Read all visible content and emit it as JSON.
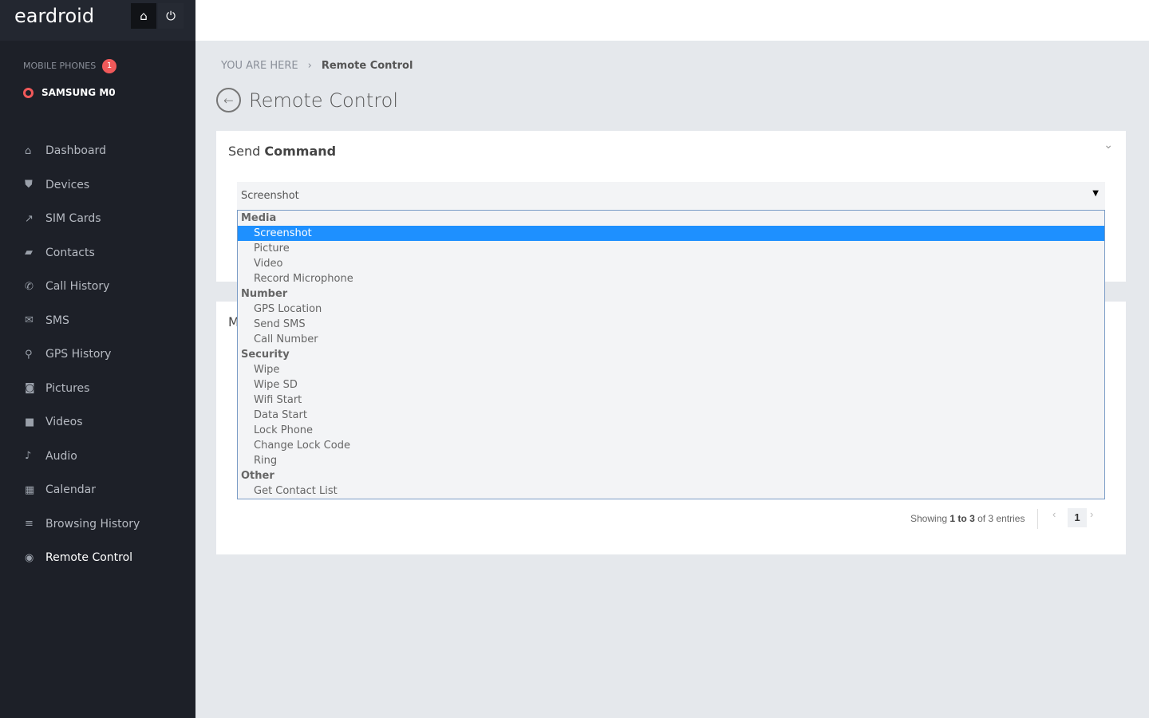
{
  "brand": {
    "logo": "eardroid",
    "home_icon": "home-icon",
    "power_icon": "power-icon"
  },
  "sidebar": {
    "section_label": "MOBILE PHONES",
    "badge": "1",
    "phone": "SAMSUNG M0",
    "items": [
      {
        "label": "Dashboard",
        "icon": "⌂"
      },
      {
        "label": "Devices",
        "icon": "⛊"
      },
      {
        "label": "SIM Cards",
        "icon": "↗"
      },
      {
        "label": "Contacts",
        "icon": "▰"
      },
      {
        "label": "Call History",
        "icon": "✆"
      },
      {
        "label": "SMS",
        "icon": "✉"
      },
      {
        "label": "GPS History",
        "icon": "⚲"
      },
      {
        "label": "Pictures",
        "icon": "◙"
      },
      {
        "label": "Videos",
        "icon": "■"
      },
      {
        "label": "Audio",
        "icon": "♪"
      },
      {
        "label": "Calendar",
        "icon": "▦"
      },
      {
        "label": "Browsing History",
        "icon": "≡"
      },
      {
        "label": "Remote Control",
        "icon": "◉"
      }
    ]
  },
  "breadcrumb": {
    "prefix": "YOU ARE HERE",
    "separator": "›",
    "current": "Remote Control"
  },
  "page": {
    "title": "Remote Control"
  },
  "send_command": {
    "title_light": "Send ",
    "title_bold": "Command",
    "selected": "Screenshot",
    "options": [
      {
        "label": "Media",
        "group": true
      },
      {
        "label": "Screenshot",
        "selected": true
      },
      {
        "label": "Picture"
      },
      {
        "label": "Video"
      },
      {
        "label": "Record Microphone"
      },
      {
        "label": "Number",
        "group": true
      },
      {
        "label": "GPS Location"
      },
      {
        "label": "Send SMS"
      },
      {
        "label": "Call Number"
      },
      {
        "label": "Security",
        "group": true
      },
      {
        "label": "Wipe"
      },
      {
        "label": "Wipe SD"
      },
      {
        "label": "Wifi Start"
      },
      {
        "label": "Data Start"
      },
      {
        "label": "Lock Phone"
      },
      {
        "label": "Change Lock Code"
      },
      {
        "label": "Ring"
      },
      {
        "label": "Other",
        "group": true
      },
      {
        "label": "Get Contact List"
      }
    ]
  },
  "second_panel": {
    "title_partial": "M"
  },
  "table_info": {
    "showing": "Showing ",
    "from": "1",
    "to_word": " to ",
    "to": "3",
    "of": " of 3 entries"
  },
  "pagination": {
    "prev": "‹",
    "page": "1",
    "next": "›"
  }
}
